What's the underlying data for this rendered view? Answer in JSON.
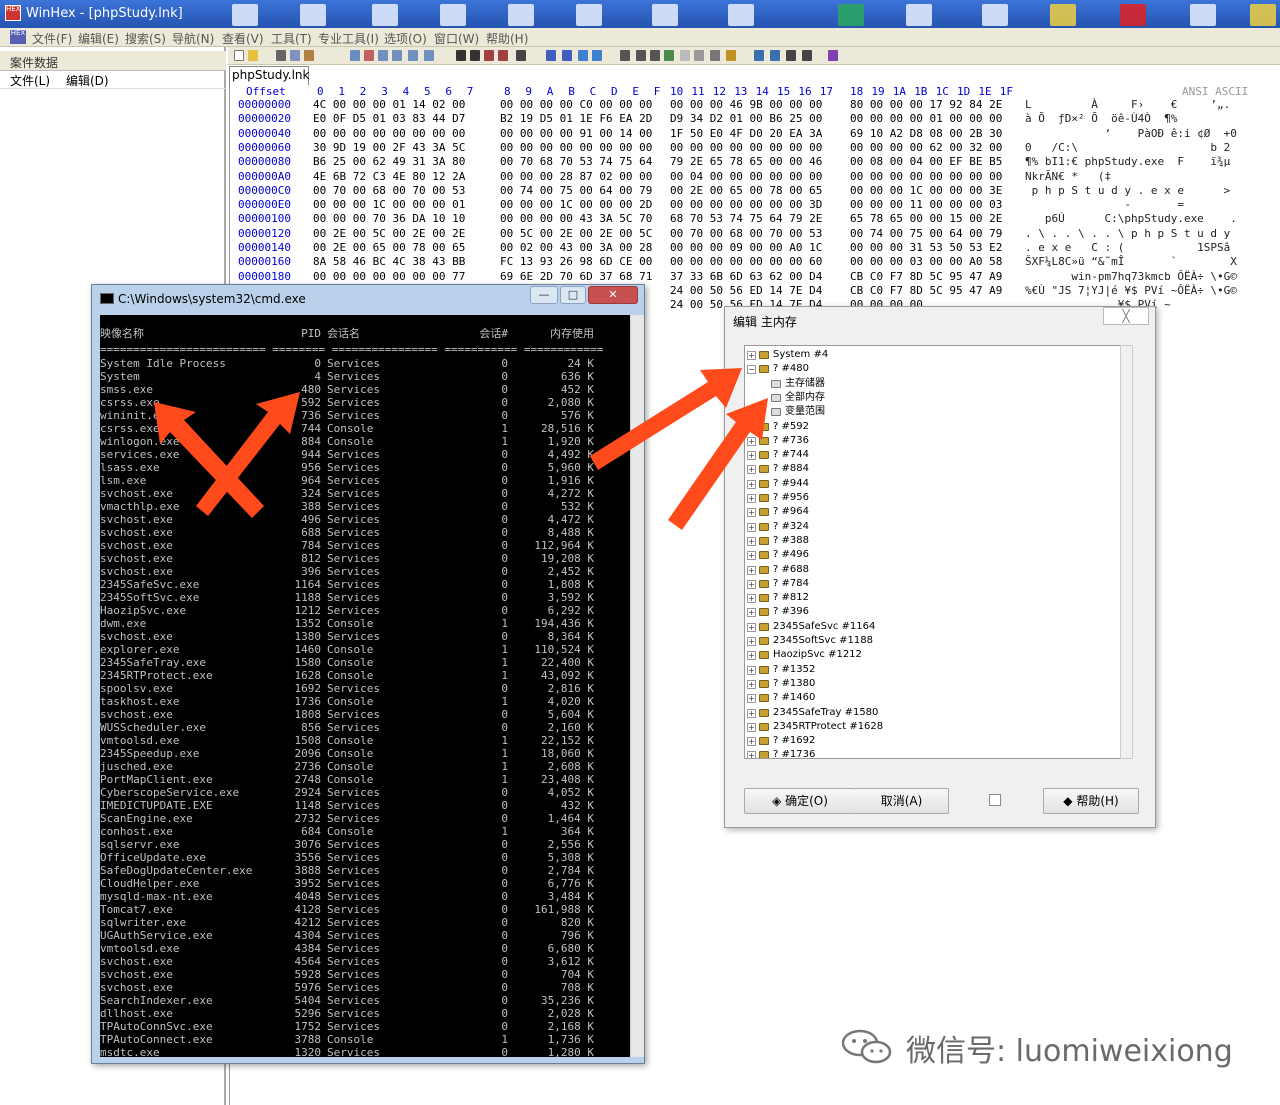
{
  "window": {
    "title": "WinHex - [phpStudy.lnk]",
    "logo_text": "HEX"
  },
  "menu": [
    "文件(F)",
    "编辑(E)",
    "搜索(S)",
    "导航(N)",
    "查看(V)",
    "工具(T)",
    "专业工具(I)",
    "选项(O)",
    "窗口(W)",
    "帮助(H)"
  ],
  "left_panel": {
    "header": "案件数据",
    "menu": [
      "文件(L)",
      "编辑(D)"
    ]
  },
  "tab": {
    "label": "phpStudy.lnk"
  },
  "hex": {
    "offset_label": "Offset",
    "col_headers": [
      "0",
      "1",
      "2",
      "3",
      "4",
      "5",
      "6",
      "7",
      "8",
      "9",
      "A",
      "B",
      "C",
      "D",
      "E",
      "F",
      "10",
      "11",
      "12",
      "13",
      "14",
      "15",
      "16",
      "17",
      "18",
      "19",
      "1A",
      "1B",
      "1C",
      "1D",
      "1E",
      "1F"
    ],
    "ascii_label": "ANSI ASCII",
    "rows": [
      {
        "off": "00000000",
        "b": [
          "4C 00 00 00 01 14 02 00",
          "00 00 00 00 C0 00 00 00",
          "00 00 00 46 9B 00 00 00",
          "80 00 00 00 17 92 84 2E"
        ],
        "a": "L         À     F›    €     ’„."
      },
      {
        "off": "00000020",
        "b": [
          "E0 0F D5 01 03 83 44 D7",
          "B2 19 D5 01 1E F6 EA 2D",
          "D9 34 D2 01 00 B6 25 00",
          "00 00 00 00 01 00 00 00"
        ],
        "a": "à Õ  ƒD×² Õ  öê-Ù4Ò  ¶%"
      },
      {
        "off": "00000040",
        "b": [
          "00 00 00 00 00 00 00 00",
          "00 00 00 00 91 00 14 00",
          "1F 50 E0 4F D0 20 EA 3A",
          "69 10 A2 D8 08 00 2B 30"
        ],
        "a": "            ‘    PàOÐ ê:i ¢Ø  +0"
      },
      {
        "off": "00000060",
        "b": [
          "30 9D 19 00 2F 43 3A 5C",
          "00 00 00 00 00 00 00 00",
          "00 00 00 00 00 00 00 00",
          "00 00 00 00 62 00 32 00"
        ],
        "a": "0   /C:\\                    b 2"
      },
      {
        "off": "00000080",
        "b": [
          "B6 25 00 62 49 31 3A 80",
          "00 70 68 70 53 74 75 64",
          "79 2E 65 78 65 00 00 46",
          "00 08 00 04 00 EF BE B5"
        ],
        "a": "¶% bI1:€ phpStudy.exe  F    ï¾µ"
      },
      {
        "off": "000000A0",
        "b": [
          "4E 6B 72 C3 4E 80 12 2A",
          "00 00 00 28 87 02 00 00",
          "00 04 00 00 00 00 00 00",
          "00 00 00 00 00 00 00 00"
        ],
        "a": "NkrÃN€ *   (‡"
      },
      {
        "off": "000000C0",
        "b": [
          "00 70 00 68 00 70 00 53",
          "00 74 00 75 00 64 00 79",
          "00 2E 00 65 00 78 00 65",
          "00 00 00 1C 00 00 00 3E"
        ],
        "a": " p h p S t u d y . e x e      >"
      },
      {
        "off": "000000E0",
        "b": [
          "00 00 00 1C 00 00 00 01",
          "00 00 00 1C 00 00 00 2D",
          "00 00 00 00 00 00 00 3D",
          "00 00 00 11 00 00 00 03"
        ],
        "a": "               -       ="
      },
      {
        "off": "00000100",
        "b": [
          "00 00 00 70 36 DA 10 10",
          "00 00 00 00 43 3A 5C 70",
          "68 70 53 74 75 64 79 2E",
          "65 78 65 00 00 15 00 2E"
        ],
        "a": "   p6Ú      C:\\phpStudy.exe    ."
      },
      {
        "off": "00000120",
        "b": [
          "00 2E 00 5C 00 2E 00 2E",
          "00 5C 00 2E 00 2E 00 5C",
          "00 70 00 68 00 70 00 53",
          "00 74 00 75 00 64 00 79"
        ],
        "a": ". \\ . . \\ . . \\ p h p S t u d y"
      },
      {
        "off": "00000140",
        "b": [
          "00 2E 00 65 00 78 00 65",
          "00 02 00 43 00 3A 00 28",
          "00 00 00 09 00 00 A0 1C",
          "00 00 00 31 53 50 53 E2"
        ],
        "a": ". e x e   C : (           1SPSâ"
      },
      {
        "off": "00000160",
        "b": [
          "8A 58 46 BC 4C 38 43 BB",
          "FC 13 93 26 98 6D CE 00",
          "00 00 00 00 00 00 00 60",
          "00 00 00 03 00 00 A0 58"
        ],
        "a": "ŠXF¼L8C»ü “&˜mÎ       `        X"
      },
      {
        "off": "00000180",
        "b": [
          "00 00 00 00 00 00 00 77",
          "69 6E 2D 70 6D 37 68 71",
          "37 33 6B 6D 63 62 00 D4",
          "CB C0 F7 8D 5C 95 47 A9"
        ],
        "a": "       win-pm7hq73kmcb ÔËÀ÷ \\•G©"
      },
      {
        "off": "000001A0",
        "b": [
          "",
          "",
          "24 00 50 56 ED 14 7E D4",
          "CB C0 F7 8D 5C 95 47 A9"
        ],
        "a": "%€Ù \"JS 7¦YJ|é ¥$ PVí ~ÔËÀ÷ \\•G©"
      },
      {
        "off": "000001C0",
        "b": [
          "",
          "",
          "24 00 50 56 ED 14 7E D4",
          "00 00 00 00"
        ],
        "a": "              ¥$ PVí ~"
      }
    ]
  },
  "cmd": {
    "title": "C:\\Windows\\system32\\cmd.exe",
    "headers": [
      "映像名称",
      "PID",
      "会话名",
      "会话#",
      "内存使用"
    ],
    "separator": "========================= ======== ================ =========== ============",
    "rows": [
      [
        "System Idle Process",
        "0",
        "Services",
        "0",
        "24 K"
      ],
      [
        "System",
        "4",
        "Services",
        "0",
        "636 K"
      ],
      [
        "smss.exe",
        "480",
        "Services",
        "0",
        "452 K"
      ],
      [
        "csrss.exe",
        "592",
        "Services",
        "0",
        "2,080 K"
      ],
      [
        "wininit.exe",
        "736",
        "Services",
        "0",
        "576 K"
      ],
      [
        "csrss.exe",
        "744",
        "Console",
        "1",
        "28,516 K"
      ],
      [
        "winlogon.exe",
        "884",
        "Console",
        "1",
        "1,920 K"
      ],
      [
        "services.exe",
        "944",
        "Services",
        "0",
        "4,492 K"
      ],
      [
        "lsass.exe",
        "956",
        "Services",
        "0",
        "5,960 K"
      ],
      [
        "lsm.exe",
        "964",
        "Services",
        "0",
        "1,916 K"
      ],
      [
        "svchost.exe",
        "324",
        "Services",
        "0",
        "4,272 K"
      ],
      [
        "vmacthlp.exe",
        "388",
        "Services",
        "0",
        "532 K"
      ],
      [
        "svchost.exe",
        "496",
        "Services",
        "0",
        "4,472 K"
      ],
      [
        "svchost.exe",
        "688",
        "Services",
        "0",
        "8,488 K"
      ],
      [
        "svchost.exe",
        "784",
        "Services",
        "0",
        "112,964 K"
      ],
      [
        "svchost.exe",
        "812",
        "Services",
        "0",
        "19,208 K"
      ],
      [
        "svchost.exe",
        "396",
        "Services",
        "0",
        "2,452 K"
      ],
      [
        "2345SafeSvc.exe",
        "1164",
        "Services",
        "0",
        "1,808 K"
      ],
      [
        "2345SoftSvc.exe",
        "1188",
        "Services",
        "0",
        "3,592 K"
      ],
      [
        "HaozipSvc.exe",
        "1212",
        "Services",
        "0",
        "6,292 K"
      ],
      [
        "dwm.exe",
        "1352",
        "Console",
        "1",
        "194,436 K"
      ],
      [
        "svchost.exe",
        "1380",
        "Services",
        "0",
        "8,364 K"
      ],
      [
        "explorer.exe",
        "1460",
        "Console",
        "1",
        "110,524 K"
      ],
      [
        "2345SafeTray.exe",
        "1580",
        "Console",
        "1",
        "22,400 K"
      ],
      [
        "2345RTProtect.exe",
        "1628",
        "Console",
        "1",
        "43,092 K"
      ],
      [
        "spoolsv.exe",
        "1692",
        "Services",
        "0",
        "2,816 K"
      ],
      [
        "taskhost.exe",
        "1736",
        "Console",
        "1",
        "4,020 K"
      ],
      [
        "svchost.exe",
        "1808",
        "Services",
        "0",
        "5,604 K"
      ],
      [
        "WUSScheduler.exe",
        "856",
        "Services",
        "0",
        "2,160 K"
      ],
      [
        "vmtoolsd.exe",
        "1508",
        "Console",
        "1",
        "22,152 K"
      ],
      [
        "2345Speedup.exe",
        "2096",
        "Console",
        "1",
        "18,060 K"
      ],
      [
        "jusched.exe",
        "2736",
        "Console",
        "1",
        "2,608 K"
      ],
      [
        "PortMapClient.exe",
        "2748",
        "Console",
        "1",
        "23,408 K"
      ],
      [
        "CyberscopeService.exe",
        "2924",
        "Services",
        "0",
        "4,052 K"
      ],
      [
        "IMEDICTUPDATE.EXE",
        "1148",
        "Services",
        "0",
        "432 K"
      ],
      [
        "ScanEngine.exe",
        "2732",
        "Services",
        "0",
        "1,464 K"
      ],
      [
        "conhost.exe",
        "684",
        "Console",
        "1",
        "364 K"
      ],
      [
        "sqlservr.exe",
        "3076",
        "Services",
        "0",
        "2,556 K"
      ],
      [
        "OfficeUpdate.exe",
        "3556",
        "Services",
        "0",
        "5,308 K"
      ],
      [
        "SafeDogUpdateCenter.exe",
        "3888",
        "Services",
        "0",
        "2,784 K"
      ],
      [
        "CloudHelper.exe",
        "3952",
        "Services",
        "0",
        "6,776 K"
      ],
      [
        "mysqld-max-nt.exe",
        "4048",
        "Services",
        "0",
        "3,484 K"
      ],
      [
        "Tomcat7.exe",
        "4128",
        "Services",
        "0",
        "161,988 K"
      ],
      [
        "sqlwriter.exe",
        "4212",
        "Services",
        "0",
        "820 K"
      ],
      [
        "UGAuthService.exe",
        "4304",
        "Services",
        "0",
        "796 K"
      ],
      [
        "vmtoolsd.exe",
        "4384",
        "Services",
        "0",
        "6,680 K"
      ],
      [
        "svchost.exe",
        "4564",
        "Services",
        "0",
        "3,612 K"
      ],
      [
        "svchost.exe",
        "5928",
        "Services",
        "0",
        "704 K"
      ],
      [
        "svchost.exe",
        "5976",
        "Services",
        "0",
        "708 K"
      ],
      [
        "SearchIndexer.exe",
        "5404",
        "Services",
        "0",
        "35,236 K"
      ],
      [
        "dllhost.exe",
        "5296",
        "Services",
        "0",
        "2,028 K"
      ],
      [
        "TPAutoConnSvc.exe",
        "1752",
        "Services",
        "0",
        "2,168 K"
      ],
      [
        "TPAutoConnect.exe",
        "3788",
        "Console",
        "1",
        "1,736 K"
      ],
      [
        "msdtc.exe",
        "1320",
        "Services",
        "0",
        "1,280 K"
      ]
    ]
  },
  "dialog": {
    "title": "编辑 主内存",
    "close": "╳",
    "tree": [
      {
        "label": "System #4",
        "exp": "+"
      },
      {
        "label": "? #480",
        "exp": "−"
      },
      {
        "label": "主存储器",
        "child": true
      },
      {
        "label": "全部内存",
        "child": true
      },
      {
        "label": "变量范围",
        "child": true
      },
      {
        "label": "? #592",
        "exp": "+"
      },
      {
        "label": "? #736",
        "exp": "+"
      },
      {
        "label": "? #744",
        "exp": "+"
      },
      {
        "label": "? #884",
        "exp": "+"
      },
      {
        "label": "? #944",
        "exp": "+"
      },
      {
        "label": "? #956",
        "exp": "+"
      },
      {
        "label": "? #964",
        "exp": "+"
      },
      {
        "label": "? #324",
        "exp": "+"
      },
      {
        "label": "? #388",
        "exp": "+"
      },
      {
        "label": "? #496",
        "exp": "+"
      },
      {
        "label": "? #688",
        "exp": "+"
      },
      {
        "label": "? #784",
        "exp": "+"
      },
      {
        "label": "? #812",
        "exp": "+"
      },
      {
        "label": "? #396",
        "exp": "+"
      },
      {
        "label": "2345SafeSvc #1164",
        "exp": "+"
      },
      {
        "label": "2345SoftSvc #1188",
        "exp": "+"
      },
      {
        "label": "HaozipSvc #1212",
        "exp": "+"
      },
      {
        "label": "? #1352",
        "exp": "+"
      },
      {
        "label": "? #1380",
        "exp": "+"
      },
      {
        "label": "? #1460",
        "exp": "+"
      },
      {
        "label": "2345SafeTray #1580",
        "exp": "+"
      },
      {
        "label": "2345RTProtect #1628",
        "exp": "+"
      },
      {
        "label": "? #1692",
        "exp": "+"
      },
      {
        "label": "? #1736",
        "exp": "+"
      }
    ],
    "ok": "确定(O)",
    "cancel": "取消(A)",
    "help": "帮助(H)"
  },
  "watermark": "微信号: luomiweixiong",
  "colors": {
    "arrow": "#ff4a1c",
    "titlebar": "#2a5cbf",
    "hex_offset": "#0000d0"
  }
}
